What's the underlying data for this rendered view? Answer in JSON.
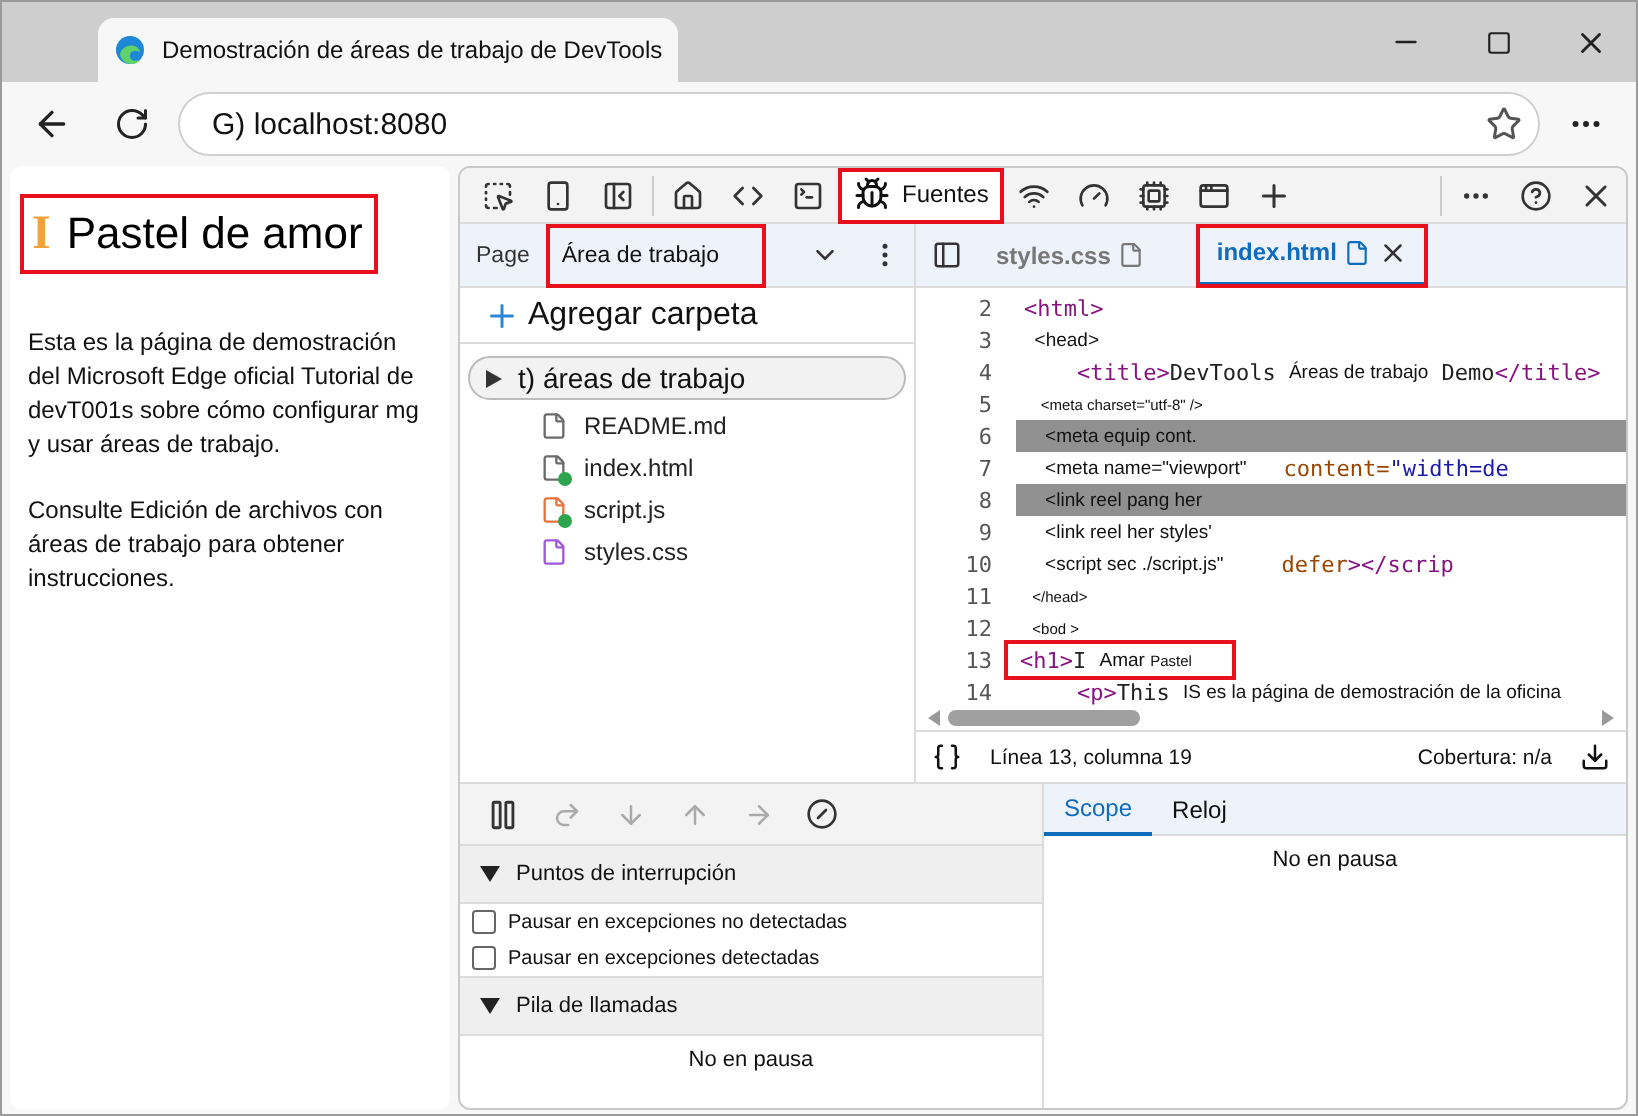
{
  "browser_tab": {
    "title": "Demostración de áreas de trabajo de DevTools"
  },
  "address_bar": {
    "url": "G) localhost:8080"
  },
  "page": {
    "heading": {
      "marker": "I",
      "text": "Pastel de amor",
      "outlined": true
    },
    "paragraphs": [
      "Esta es la página de demostración del Microsoft Edge oficial Tutorial de devT001s sobre cómo configurar mg y usar áreas de trabajo.",
      "Consulte Edición de archivos con áreas de trabajo para obtener instrucciones."
    ]
  },
  "devtools": {
    "panel_tab": {
      "label": "Fuentes",
      "selected": true,
      "outlined": true
    },
    "navigator": {
      "tabs": [
        {
          "label": "Page",
          "selected": false,
          "outlined": false
        },
        {
          "label": "Área de trabajo",
          "selected": true,
          "outlined": true
        }
      ],
      "add_folder": "Agregar carpeta",
      "folder": {
        "name": "t) áreas de trabajo",
        "children": [
          {
            "name": "README.md",
            "color": "#6b6b6b",
            "modified": false
          },
          {
            "name": "index.html",
            "color": "#6b6b6b",
            "modified": true
          },
          {
            "name": "script.js",
            "color": "#e8743b",
            "modified": true
          },
          {
            "name": "styles.css",
            "color": "#a259d9",
            "modified": false
          }
        ]
      }
    },
    "editor": {
      "tabs": [
        {
          "label": "styles.css",
          "selected": false,
          "outlined": false,
          "closable": false
        },
        {
          "label": "index.html",
          "selected": true,
          "outlined": true,
          "closable": true
        }
      ],
      "lines": [
        {
          "number": "2",
          "highlighted": false,
          "outlined": false,
          "tokens": [
            {
              "kind": "tag",
              "text": "<html>"
            }
          ]
        },
        {
          "number": "3",
          "highlighted": false,
          "outlined": false,
          "tokens": [
            {
              "kind": "note",
              "text": "  <head>"
            }
          ]
        },
        {
          "number": "4",
          "highlighted": false,
          "outlined": false,
          "tokens": [
            {
              "kind": "tag",
              "text": "    <title>"
            },
            {
              "kind": "text",
              "text": "DevTools "
            },
            {
              "kind": "note",
              "text": "Áreas de trabajo"
            },
            {
              "kind": "text",
              "text": " Demo"
            },
            {
              "kind": "tag",
              "text": "</title>"
            }
          ]
        },
        {
          "number": "5",
          "highlighted": false,
          "outlined": false,
          "tokens": [
            {
              "kind": "small",
              "text": "    <meta charset=\"utf-8\" />"
            }
          ]
        },
        {
          "number": "6",
          "highlighted": true,
          "outlined": false,
          "tokens": [
            {
              "kind": "note",
              "text": "    <meta equip cont."
            }
          ]
        },
        {
          "number": "7",
          "highlighted": false,
          "outlined": false,
          "tokens": [
            {
              "kind": "note",
              "text": "    <meta name=\"viewport\"       "
            },
            {
              "kind": "attr",
              "text": "content="
            },
            {
              "kind": "string",
              "text": "\"width=de"
            }
          ]
        },
        {
          "number": "8",
          "highlighted": true,
          "outlined": false,
          "tokens": [
            {
              "kind": "note",
              "text": "    <link reel pang her"
            }
          ]
        },
        {
          "number": "9",
          "highlighted": false,
          "outlined": false,
          "tokens": [
            {
              "kind": "note",
              "text": "    <link reel her styles'"
            }
          ]
        },
        {
          "number": "10",
          "highlighted": false,
          "outlined": false,
          "tokens": [
            {
              "kind": "note",
              "text": "    <script sec ./script.js\"           "
            },
            {
              "kind": "attr",
              "text": "defer"
            },
            {
              "kind": "tag",
              "text": "></scrip"
            }
          ]
        },
        {
          "number": "11",
          "highlighted": false,
          "outlined": false,
          "tokens": [
            {
              "kind": "small",
              "text": "  </head>"
            }
          ]
        },
        {
          "number": "12",
          "highlighted": false,
          "outlined": false,
          "tokens": [
            {
              "kind": "small",
              "text": "  <bod >"
            }
          ]
        },
        {
          "number": "13",
          "highlighted": false,
          "outlined": true,
          "tokens": [
            {
              "kind": "tag",
              "text": "<h1>"
            },
            {
              "kind": "text",
              "text": "I "
            },
            {
              "kind": "note",
              "text": "Amar "
            },
            {
              "kind": "small",
              "text": "Pastel"
            }
          ]
        },
        {
          "number": "14",
          "highlighted": false,
          "outlined": false,
          "tokens": [
            {
              "kind": "tag",
              "text": "    <p>"
            },
            {
              "kind": "text",
              "text": "This "
            },
            {
              "kind": "note",
              "text": "IS es la página de demostración de la oficina"
            }
          ]
        }
      ],
      "position": "Línea 13, columna 19",
      "coverage": "Cobertura: n/a"
    },
    "debugger": {
      "sections": [
        {
          "title": "Puntos de interrupción",
          "options": [
            {
              "label": "Pausar en excepciones no detectadas",
              "checked": false
            },
            {
              "label": "Pausar en excepciones detectadas",
              "checked": false
            }
          ]
        },
        {
          "title": "Pila de llamadas",
          "message": "No en pausa"
        }
      ],
      "side_tabs": [
        {
          "label": "Scope",
          "selected": true
        },
        {
          "label": "Reloj",
          "selected": false
        }
      ],
      "side_message": "No en pausa"
    }
  }
}
